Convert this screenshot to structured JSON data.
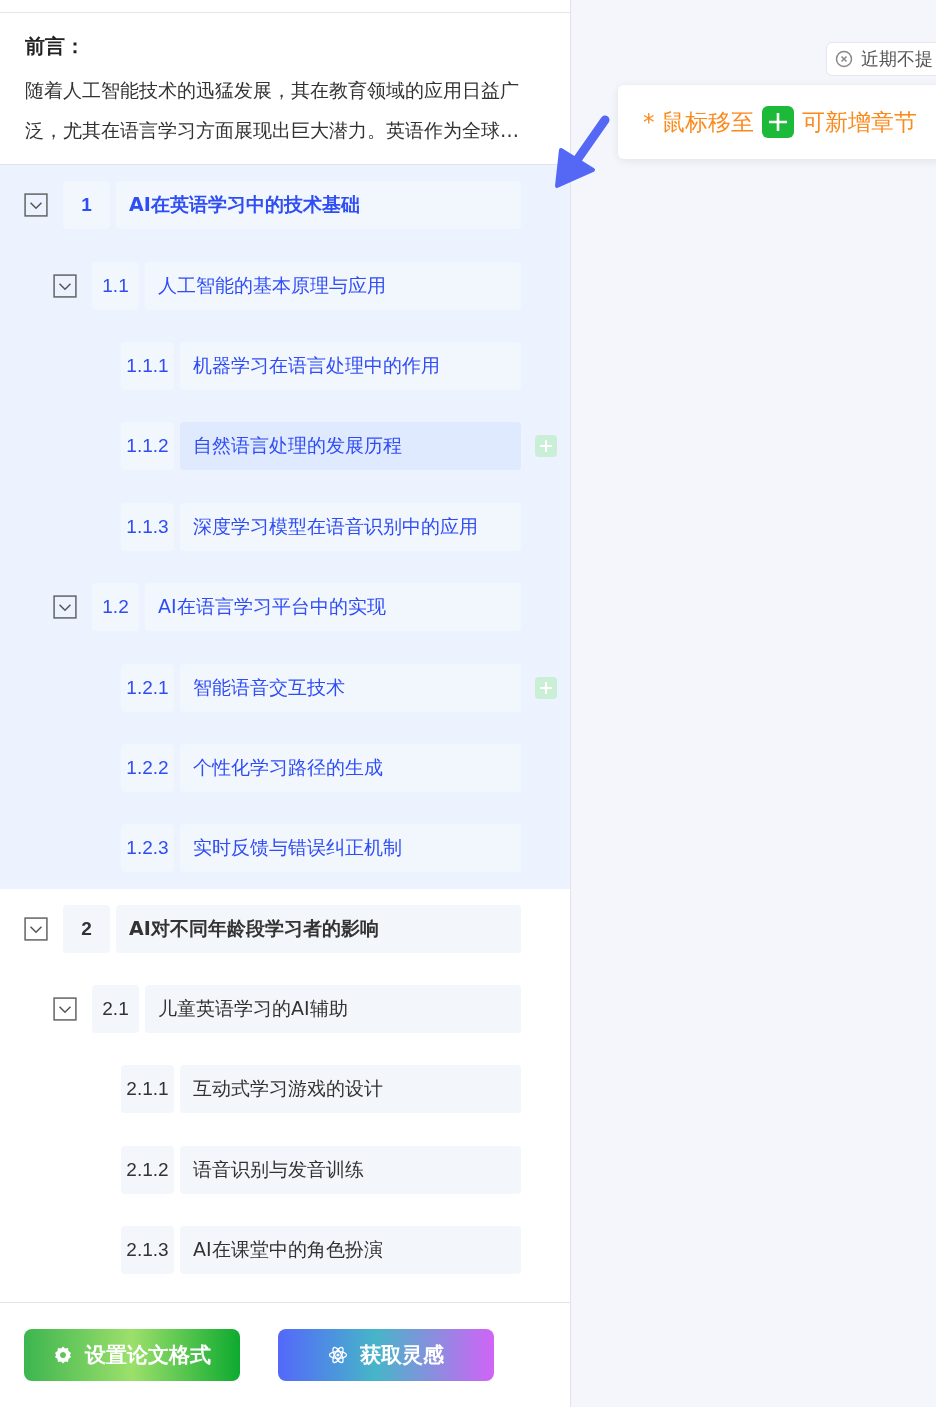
{
  "preface": {
    "title": "前言：",
    "text": "随着人工智能技术的迅猛发展，其在教育领域的应用日益广泛，尤其在语言学习方面展现出巨大潜力。英语作为全球…"
  },
  "outline": [
    {
      "number": "1",
      "title": "AI在英语学习中的技术基础",
      "expanded": true,
      "selected": true,
      "hovered": false,
      "add_button": false,
      "children": [
        {
          "number": "1.1",
          "title": "人工智能的基本原理与应用",
          "expanded": true,
          "hovered": false,
          "add_button": false,
          "children": [
            {
              "number": "1.1.1",
              "title": "机器学习在语言处理中的作用",
              "hovered": false,
              "add_button": false
            },
            {
              "number": "1.1.2",
              "title": "自然语言处理的发展历程",
              "hovered": true,
              "add_button": true
            },
            {
              "number": "1.1.3",
              "title": "深度学习模型在语音识别中的应用",
              "hovered": false,
              "add_button": false
            }
          ]
        },
        {
          "number": "1.2",
          "title": "AI在语言学习平台中的实现",
          "expanded": true,
          "hovered": false,
          "add_button": false,
          "children": [
            {
              "number": "1.2.1",
              "title": "智能语音交互技术",
              "hovered": false,
              "add_button": true
            },
            {
              "number": "1.2.2",
              "title": "个性化学习路径的生成",
              "hovered": false,
              "add_button": false
            },
            {
              "number": "1.2.3",
              "title": "实时反馈与错误纠正机制",
              "hovered": false,
              "add_button": false
            }
          ]
        }
      ]
    },
    {
      "number": "2",
      "title": "AI对不同年龄段学习者的影响",
      "expanded": true,
      "selected": false,
      "hovered": false,
      "add_button": false,
      "children": [
        {
          "number": "2.1",
          "title": "儿童英语学习的AI辅助",
          "expanded": true,
          "hovered": false,
          "add_button": false,
          "children": [
            {
              "number": "2.1.1",
              "title": "互动式学习游戏的设计",
              "hovered": false,
              "add_button": false
            },
            {
              "number": "2.1.2",
              "title": "语音识别与发音训练",
              "hovered": false,
              "add_button": false
            },
            {
              "number": "2.1.3",
              "title": "AI在课堂中的角色扮演",
              "hovered": false,
              "add_button": false
            }
          ]
        }
      ]
    }
  ],
  "buttons": [
    {
      "kind": "format",
      "label": "设置论文格式"
    },
    {
      "kind": "inspire",
      "label": "获取灵感"
    }
  ],
  "tip": {
    "dismiss_label": "近期不提",
    "prefix": "* 鼠标移至",
    "suffix": "可新增章节"
  }
}
